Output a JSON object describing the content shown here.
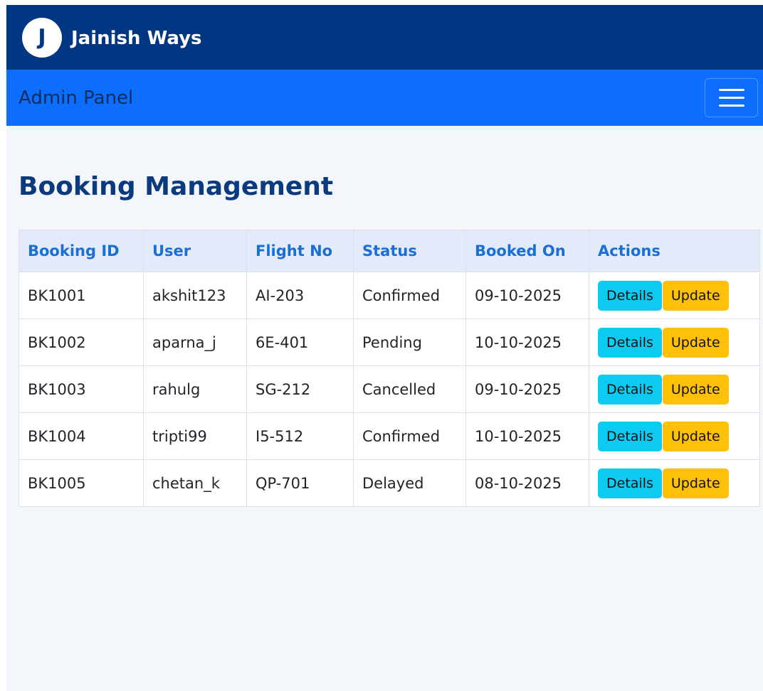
{
  "header": {
    "logo_letter": "J",
    "brand": "Jainish Ways"
  },
  "navbar": {
    "title": "Admin Panel",
    "menu_icon": "hamburger-menu-icon"
  },
  "main": {
    "title": "Booking Management"
  },
  "table": {
    "columns": [
      "Booking ID",
      "User",
      "Flight No",
      "Status",
      "Booked On",
      "Actions"
    ],
    "rows": [
      {
        "id": "BK1001",
        "user": "akshit123",
        "flight": "AI-203",
        "status": "Confirmed",
        "booked_on": "09-10-2025"
      },
      {
        "id": "BK1002",
        "user": "aparna_j",
        "flight": "6E-401",
        "status": "Pending",
        "booked_on": "10-10-2025"
      },
      {
        "id": "BK1003",
        "user": "rahulg",
        "flight": "SG-212",
        "status": "Cancelled",
        "booked_on": "09-10-2025"
      },
      {
        "id": "BK1004",
        "user": "tripti99",
        "flight": "I5-512",
        "status": "Confirmed",
        "booked_on": "10-10-2025"
      },
      {
        "id": "BK1005",
        "user": "chetan_k",
        "flight": "QP-701",
        "status": "Delayed",
        "booked_on": "08-10-2025"
      }
    ],
    "actions": {
      "details_label": "Details",
      "update_label": "Update"
    }
  },
  "colors": {
    "topbar": "#003682",
    "navbar": "#0d6efd",
    "heading": "#0b3a7e",
    "table_header_bg": "#e3ebfa",
    "table_header_text": "#1a6fd6",
    "details_button": "#0dcaf0",
    "update_button": "#ffc107",
    "page_bg": "#f3f6fa"
  }
}
